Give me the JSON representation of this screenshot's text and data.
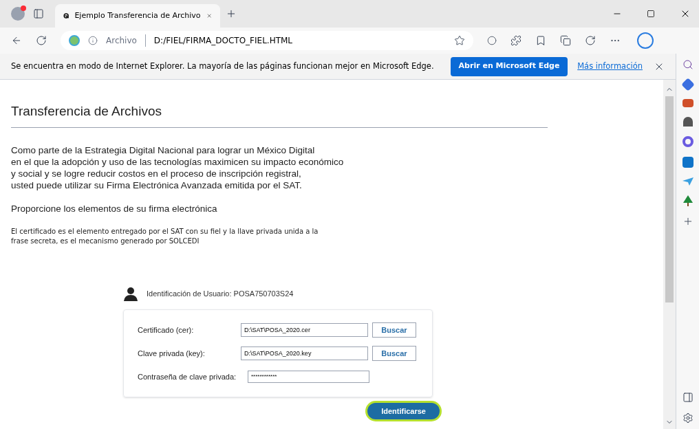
{
  "tab": {
    "title": "Ejemplo Transferencia de Archivo",
    "selected": true
  },
  "address": {
    "scheme": "Archivo",
    "url": "D:/FIEL/FIRMA_DOCTO_FIEL.HTML"
  },
  "infobar": {
    "message": "Se encuentra en modo de Internet Explorer. La mayoría de las páginas funcionan mejor en Microsoft Edge.",
    "button": "Abrir en Microsoft Edge",
    "link": "Más información"
  },
  "page": {
    "title": "Transferencia de Archivos",
    "intro": [
      "Como parte de la Estrategia Digital Nacional para lograr un México Digital",
      "en el que la adopción y uso de las tecnologías maximicen su impacto económico",
      "y social y se logre reducir costos en el proceso de inscripción registral,",
      "usted puede utilizar su Firma Electrónica Avanzada emitida por el SAT."
    ],
    "subtitle": "Proporcione los elementos de su firma electrónica",
    "note": [
      "El certificado es el elemento entregado por el SAT con su fiel y la llave privada unida a la",
      "frase secreta, es el mecanismo generado por SOLCEDI"
    ],
    "user": "Identificación de Usuario: POSA750703S24",
    "fields": [
      {
        "kind": "file",
        "label": "Certificado (cer):",
        "value": "D:\\SAT\\POSA_2020.cer",
        "button": "Buscar"
      },
      {
        "kind": "file",
        "label": "Clave privada (key):",
        "value": "D:\\SAT\\POSA_2020.key",
        "button": "Buscar"
      },
      {
        "kind": "password",
        "label": "Contraseña de clave privada:",
        "value": "************"
      }
    ],
    "submit": {
      "label": "Identificarse",
      "highlighted": true
    }
  }
}
